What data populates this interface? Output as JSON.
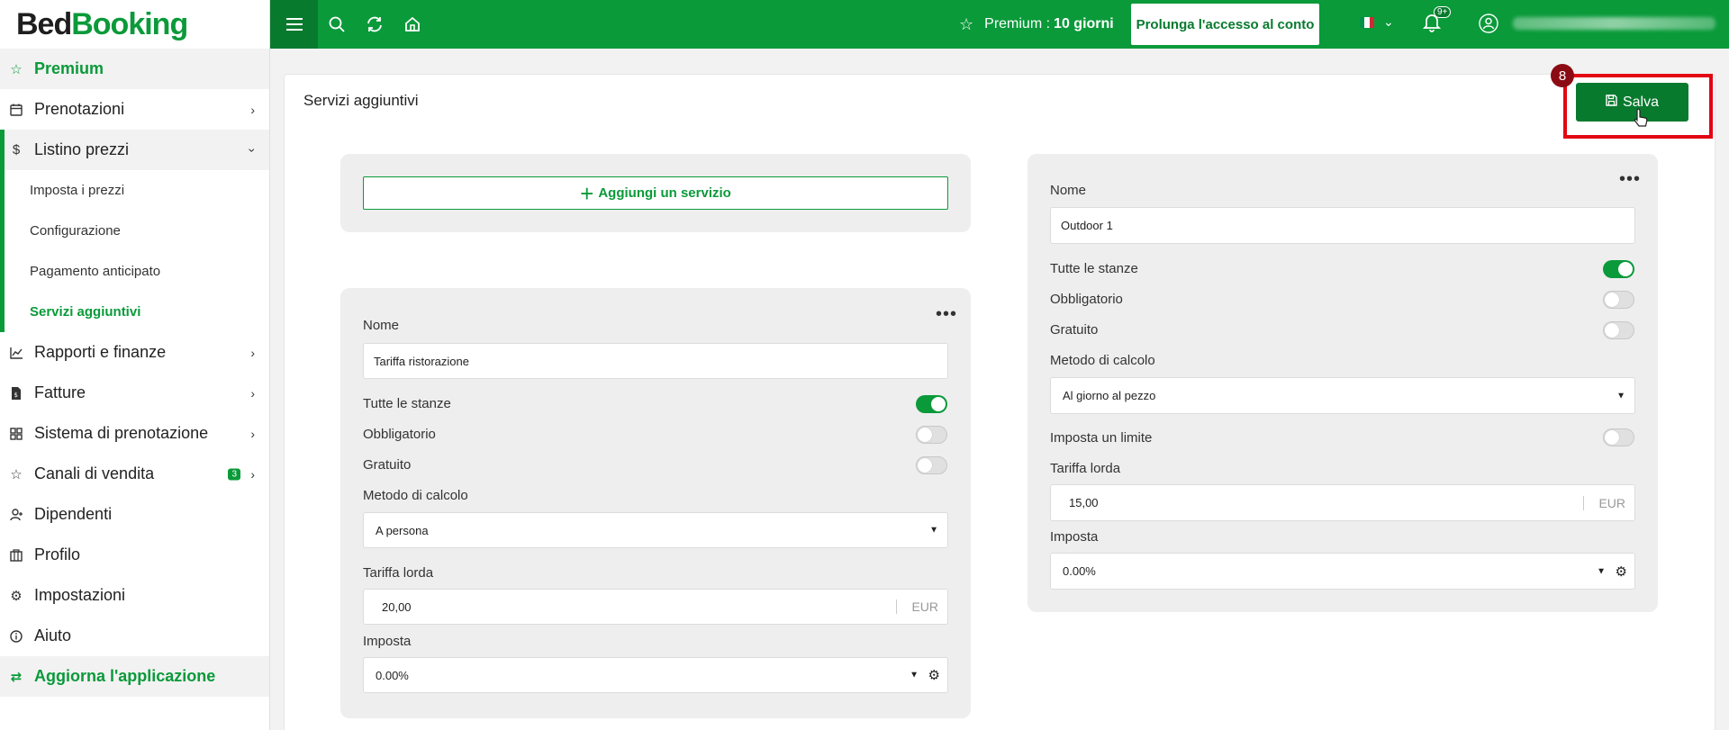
{
  "brand": {
    "bed": "Bed",
    "booking": "Booking"
  },
  "sidebar": {
    "items": [
      {
        "label": "Premium",
        "icon": "star-icon"
      },
      {
        "label": "Prenotazioni",
        "icon": "calendar-icon"
      },
      {
        "label": "Listino prezzi",
        "icon": "dollar-icon"
      },
      {
        "label": "Rapporti e finanze",
        "icon": "chart-icon"
      },
      {
        "label": "Fatture",
        "icon": "invoice-icon"
      },
      {
        "label": "Sistema di prenotazione",
        "icon": "grid-icon"
      },
      {
        "label": "Canali di vendita",
        "icon": "star-icon",
        "badge": "3"
      },
      {
        "label": "Dipendenti",
        "icon": "user-add-icon"
      },
      {
        "label": "Profilo",
        "icon": "building-icon"
      },
      {
        "label": "Impostazioni",
        "icon": "gear-icon"
      },
      {
        "label": "Aiuto",
        "icon": "info-icon"
      },
      {
        "label": "Aggiorna l'applicazione",
        "icon": "refresh-icon"
      }
    ],
    "sub": [
      "Imposta i prezzi",
      "Configurazione",
      "Pagamento anticipato",
      "Servizi aggiuntivi"
    ]
  },
  "topbar": {
    "premium_label": "Premium :",
    "premium_days": "10 giorni",
    "extend_button": "Prolunga l'accesso al conto",
    "notifications_count": "9+",
    "flag_colors": [
      "#009246",
      "#ffffff",
      "#ce2b37"
    ]
  },
  "page": {
    "title": "Servizi aggiuntivi",
    "save_label": "Salva",
    "step_number": "8",
    "add_service_label": "Aggiungi un servizio"
  },
  "labels": {
    "name": "Nome",
    "all_rooms": "Tutte le stanze",
    "mandatory": "Obbligatorio",
    "free": "Gratuito",
    "calc_method": "Metodo di calcolo",
    "set_limit": "Imposta un limite",
    "gross_rate": "Tariffa lorda",
    "tax": "Imposta",
    "currency": "EUR"
  },
  "services": [
    {
      "name": "Tariffa ristorazione",
      "all_rooms": true,
      "mandatory": false,
      "free": false,
      "calc_method": "A persona",
      "gross_rate": "20,00",
      "tax": "0.00%"
    },
    {
      "name": "Outdoor 1",
      "all_rooms": true,
      "mandatory": false,
      "free": false,
      "calc_method": "Al giorno al pezzo",
      "set_limit": false,
      "gross_rate": "15,00",
      "tax": "0.00%"
    }
  ],
  "colors": {
    "primary": "#0a9a3a",
    "primary_dark": "#087a2e",
    "highlight": "#e30613"
  }
}
